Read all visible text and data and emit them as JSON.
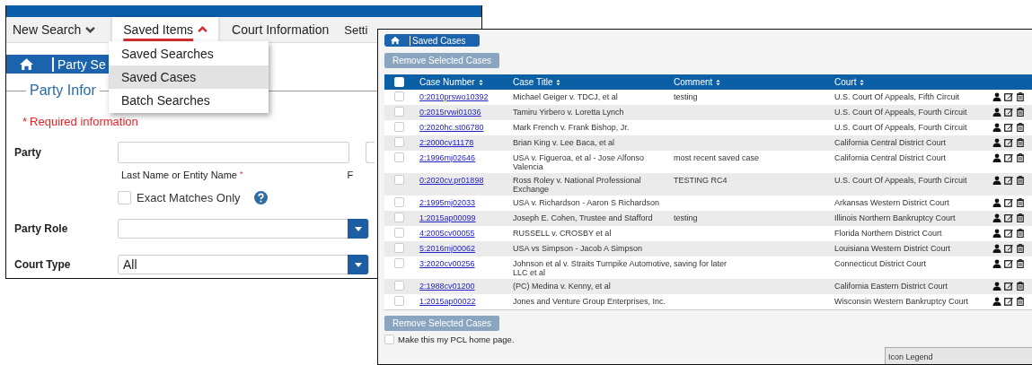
{
  "search_window": {
    "nav": [
      {
        "label": "New Search",
        "kind": "menu",
        "expanded": false,
        "selected": false
      },
      {
        "label": "Saved Items",
        "kind": "menu",
        "expanded": true,
        "selected": true
      },
      {
        "label": "Court Information",
        "kind": "link",
        "selected": false
      },
      {
        "label": "Setti",
        "kind": "link",
        "selected": false
      }
    ],
    "dropdown": [
      {
        "label": "Saved Searches",
        "selected": false
      },
      {
        "label": "Saved Cases",
        "selected": true
      },
      {
        "label": "Batch Searches",
        "selected": false
      }
    ],
    "breadcrumb": "Party Se",
    "section_title": "Party Infor",
    "required_mark": "*",
    "required_note": "Required information",
    "party": {
      "label": "Party",
      "hint": "Last Name or Entity Name",
      "hint_mark": "*",
      "second_hint": "F"
    },
    "exact_matches": {
      "label": "Exact Matches Only",
      "checked": false
    },
    "party_role": {
      "label": "Party Role"
    },
    "court_type": {
      "label": "Court Type",
      "value": "All"
    }
  },
  "saved_cases_window": {
    "breadcrumb": "Saved Cases",
    "remove_button": {
      "label": "Remove Selected Cases",
      "disabled": true
    },
    "table": {
      "select_all": false,
      "columns": [
        "Case Number",
        "Case Title",
        "Comment",
        "Court"
      ],
      "rows": [
        {
          "case_number": "0:2010prswo10392",
          "title": "Michael Geiger v. TDCJ, et al",
          "comment": "testing",
          "court": "U.S. Court Of Appeals, Fifth Circuit",
          "checked": false
        },
        {
          "case_number": "0:2015rvwi01036",
          "title": "Tamiru Yirbero v. Loretta Lynch",
          "court": "U.S. Court Of Appeals, Fourth Circuit",
          "checked": false
        },
        {
          "case_number": "0:2020hc.st06780",
          "title": "Mark French v. Frank Bishop, Jr.",
          "court": "U.S. Court Of Appeals, Fourth Circuit",
          "checked": false
        },
        {
          "case_number": "2:2000cv11178",
          "title": "Brian King v. Lee Baca, et al",
          "court": "California Central District Court",
          "checked": false
        },
        {
          "case_number": "2:1996mj02646",
          "title": "USA v. Figueroa, et al - Jose Alfonso Valencia",
          "comment": "most recent saved case",
          "court": "California Central District Court",
          "checked": false
        },
        {
          "case_number": "0:2020cv.pr01898",
          "title": "Ross Roley v. National Professional Exchange",
          "comment": "TESTING RC4",
          "court": "U.S. Court Of Appeals, Fourth Circuit",
          "checked": false
        },
        {
          "case_number": "2:1995mj02033",
          "title": "USA v. Richardson - Aaron S Richardson",
          "court": "Arkansas Western District Court",
          "checked": false
        },
        {
          "case_number": "1:2015ap00099",
          "title": "Joseph E. Cohen, Trustee and Stafford",
          "comment": "testing",
          "court": "Illinois Northern Bankruptcy Court",
          "checked": false
        },
        {
          "case_number": "4:2005cv00055",
          "title": "RUSSELL v. CROSBY et al",
          "court": "Florida Northern District Court",
          "checked": false
        },
        {
          "case_number": "5:2016mj00062",
          "title": "USA vs Simpson - Jacob A Simpson",
          "court": "Louisiana Western District Court",
          "checked": false
        },
        {
          "case_number": "3:2020cv00256",
          "title": "Johnson et al v. Straits Turnpike Automotive, LLC et al",
          "comment": "saving for later",
          "court": "Connecticut District Court",
          "checked": false
        },
        {
          "case_number": "2:1988cv01200",
          "title": "(PC) Medina v. Kenny, et al",
          "court": "California Eastern District Court",
          "checked": false
        },
        {
          "case_number": "1:2015ap00022",
          "title": "Jones and Venture Group Enterprises, Inc.",
          "court": "Wisconsin Western Bankruptcy Court",
          "checked": false
        }
      ]
    },
    "bottom_remove_button": {
      "label": "Remove Selected Cases",
      "disabled": true
    },
    "home_page_option": {
      "label": "Make this my PCL home page.",
      "checked": false
    },
    "icon_legend": "Icon Legend"
  }
}
